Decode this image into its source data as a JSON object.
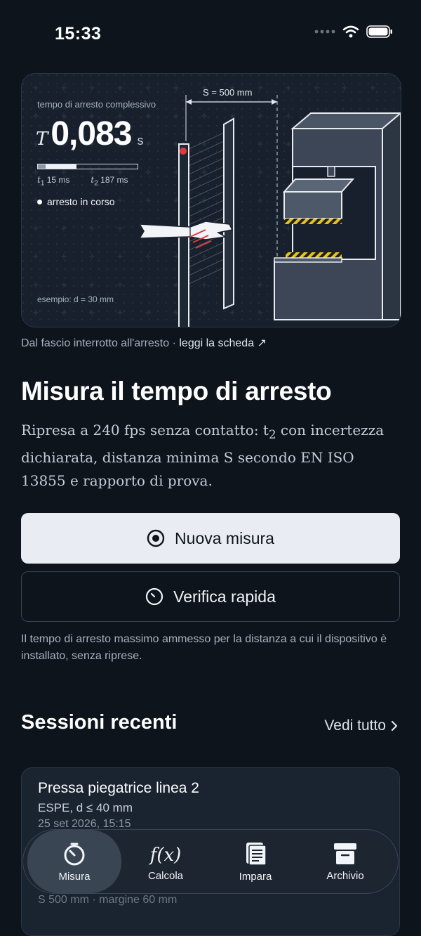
{
  "status_bar": {
    "time": "15:33"
  },
  "hero": {
    "caption": "tempo di arresto complessivo",
    "symbol": "T",
    "value": "0,083",
    "unit": "s",
    "progress_t1": 0.08,
    "progress_total": 0.39,
    "t1_label": "15 ms",
    "t2_label": "187 ms",
    "status": "arresto in corso",
    "example": "esempio: d = 30 mm",
    "s_distance": "S = 500 mm"
  },
  "caption": {
    "text": "Dal fascio interrotto all'arresto · ",
    "link": "leggi la scheda ↗"
  },
  "title": "Misura il tempo di arresto",
  "description_pre": "Ripresa a 240 fps senza contatto: t",
  "description_sub": "2",
  "description_post": " con incertezza dichiarata, distanza minima S secondo EN ISO 13855 e rapporto di prova.",
  "buttons": {
    "primary": "Nuova misura",
    "secondary": "Verifica rapida"
  },
  "help_text": "Il tempo di arresto massimo ammesso per la distanza a cui il dispositivo è installato, senza riprese.",
  "recent": {
    "title": "Sessioni recenti",
    "see_all": "Vedi tutto"
  },
  "session": {
    "name": "Pressa piegatrice linea 2",
    "subtitle": "ESPE, d ≤ 40 mm",
    "date": "25 set 2026, 15:15",
    "footer": "S 500 mm · margine 60 mm"
  },
  "tabs": [
    {
      "label": "Misura",
      "icon": "stopwatch-icon",
      "active": true
    },
    {
      "label": "Calcola",
      "icon": "function-icon",
      "active": false
    },
    {
      "label": "Impara",
      "icon": "book-icon",
      "active": false
    },
    {
      "label": "Archivio",
      "icon": "archive-box-icon",
      "active": false
    }
  ],
  "colors": {
    "background": "#0e141c",
    "card": "#17202c",
    "primary_button": "#e9edf3",
    "alert_red": "#e23a3a",
    "hazard_yellow": "#e8c21a"
  }
}
